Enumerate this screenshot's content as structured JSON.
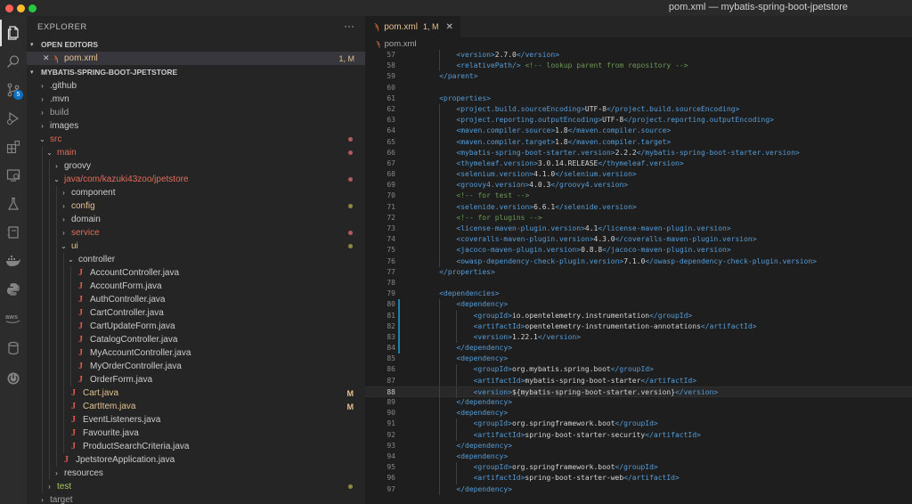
{
  "window": {
    "title": "pom.xml — mybatis-spring-boot-jpetstore"
  },
  "activity_bar": {
    "scm_badge": "5"
  },
  "sidebar": {
    "header": "EXPLORER",
    "more": "···",
    "open_editors": {
      "title": "OPEN EDITORS",
      "items": [
        {
          "close": "✕",
          "name": "pom.xml",
          "status": "1, M"
        }
      ]
    },
    "project": {
      "title": "MYBATIS-SPRING-BOOT-JPETSTORE",
      "tree": [
        {
          "label": ".github",
          "depth": 0,
          "kind": "folder-closed"
        },
        {
          "label": ".mvn",
          "depth": 0,
          "kind": "folder-closed"
        },
        {
          "label": "build",
          "depth": 0,
          "kind": "folder-closed",
          "style": "dim"
        },
        {
          "label": "images",
          "depth": 0,
          "kind": "folder-closed"
        },
        {
          "label": "src",
          "depth": 0,
          "kind": "folder-open",
          "style": "red",
          "deco": "dot-red"
        },
        {
          "label": "main",
          "depth": 1,
          "kind": "folder-open",
          "style": "red",
          "deco": "dot-red"
        },
        {
          "label": "groovy",
          "depth": 2,
          "kind": "folder-closed"
        },
        {
          "label": "java/com/kazuki43zoo/jpetstore",
          "depth": 2,
          "kind": "folder-open",
          "style": "red",
          "deco": "dot-red"
        },
        {
          "label": "component",
          "depth": 3,
          "kind": "folder-closed"
        },
        {
          "label": "config",
          "depth": 3,
          "kind": "folder-closed",
          "style": "gold",
          "deco": "dot-olive"
        },
        {
          "label": "domain",
          "depth": 3,
          "kind": "folder-closed"
        },
        {
          "label": "service",
          "depth": 3,
          "kind": "folder-closed",
          "style": "red",
          "deco": "dot-red"
        },
        {
          "label": "ui",
          "depth": 3,
          "kind": "folder-open",
          "style": "gold",
          "deco": "dot-olive"
        },
        {
          "label": "controller",
          "depth": 4,
          "kind": "folder-open"
        },
        {
          "label": "AccountController.java",
          "depth": 5,
          "kind": "java"
        },
        {
          "label": "AccountForm.java",
          "depth": 5,
          "kind": "java"
        },
        {
          "label": "AuthController.java",
          "depth": 5,
          "kind": "java"
        },
        {
          "label": "CartController.java",
          "depth": 5,
          "kind": "java"
        },
        {
          "label": "CartUpdateForm.java",
          "depth": 5,
          "kind": "java"
        },
        {
          "label": "CatalogController.java",
          "depth": 5,
          "kind": "java"
        },
        {
          "label": "MyAccountController.java",
          "depth": 5,
          "kind": "java"
        },
        {
          "label": "MyOrderController.java",
          "depth": 5,
          "kind": "java"
        },
        {
          "label": "OrderForm.java",
          "depth": 5,
          "kind": "java"
        },
        {
          "label": "Cart.java",
          "depth": 4,
          "kind": "java",
          "style": "gold",
          "deco": "M"
        },
        {
          "label": "CartItem.java",
          "depth": 4,
          "kind": "java",
          "style": "gold",
          "deco": "M"
        },
        {
          "label": "EventListeners.java",
          "depth": 4,
          "kind": "java"
        },
        {
          "label": "Favourite.java",
          "depth": 4,
          "kind": "java"
        },
        {
          "label": "ProductSearchCriteria.java",
          "depth": 4,
          "kind": "java"
        },
        {
          "label": "JpetstoreApplication.java",
          "depth": 3,
          "kind": "java"
        },
        {
          "label": "resources",
          "depth": 2,
          "kind": "folder-closed"
        },
        {
          "label": "test",
          "depth": 1,
          "kind": "folder-closed",
          "style": "green",
          "deco": "dot-olive"
        },
        {
          "label": "target",
          "depth": 0,
          "kind": "folder-closed",
          "style": "dim"
        }
      ]
    }
  },
  "editor": {
    "tab": {
      "name": "pom.xml",
      "status": "1, M",
      "close": "✕"
    },
    "breadcrumb": "pom.xml",
    "current_line": 88,
    "lines": [
      {
        "n": 57,
        "indent": 2,
        "parts": [
          [
            "t",
            "<version>"
          ],
          [
            "x",
            "2.7.0"
          ],
          [
            "t",
            "</version>"
          ]
        ]
      },
      {
        "n": 58,
        "indent": 2,
        "parts": [
          [
            "t",
            "<relativePath/>"
          ],
          [
            "x",
            " "
          ],
          [
            "c",
            "<!-- lookup parent from repository -->"
          ]
        ]
      },
      {
        "n": 59,
        "indent": 1,
        "parts": [
          [
            "t",
            "</parent>"
          ]
        ]
      },
      {
        "n": 60,
        "indent": 0,
        "parts": []
      },
      {
        "n": 61,
        "indent": 1,
        "parts": [
          [
            "t",
            "<properties>"
          ]
        ]
      },
      {
        "n": 62,
        "indent": 2,
        "parts": [
          [
            "t",
            "<project.build.sourceEncoding>"
          ],
          [
            "x",
            "UTF-8"
          ],
          [
            "t",
            "</project.build.sourceEncoding>"
          ]
        ]
      },
      {
        "n": 63,
        "indent": 2,
        "parts": [
          [
            "t",
            "<project.reporting.outputEncoding>"
          ],
          [
            "x",
            "UTF-8"
          ],
          [
            "t",
            "</project.reporting.outputEncoding>"
          ]
        ]
      },
      {
        "n": 64,
        "indent": 2,
        "parts": [
          [
            "t",
            "<maven.compiler.source>"
          ],
          [
            "x",
            "1.8"
          ],
          [
            "t",
            "</maven.compiler.source>"
          ]
        ]
      },
      {
        "n": 65,
        "indent": 2,
        "parts": [
          [
            "t",
            "<maven.compiler.target>"
          ],
          [
            "x",
            "1.8"
          ],
          [
            "t",
            "</maven.compiler.target>"
          ]
        ]
      },
      {
        "n": 66,
        "indent": 2,
        "parts": [
          [
            "t",
            "<mybatis-spring-boot-starter.version>"
          ],
          [
            "x",
            "2.2.2"
          ],
          [
            "t",
            "</mybatis-spring-boot-starter.version>"
          ]
        ]
      },
      {
        "n": 67,
        "indent": 2,
        "parts": [
          [
            "t",
            "<thymeleaf.version>"
          ],
          [
            "x",
            "3.0.14.RELEASE"
          ],
          [
            "t",
            "</thymeleaf.version>"
          ]
        ]
      },
      {
        "n": 68,
        "indent": 2,
        "parts": [
          [
            "t",
            "<selenium.version>"
          ],
          [
            "x",
            "4.1.0"
          ],
          [
            "t",
            "</selenium.version>"
          ]
        ]
      },
      {
        "n": 69,
        "indent": 2,
        "parts": [
          [
            "t",
            "<groovy4.version>"
          ],
          [
            "x",
            "4.0.3"
          ],
          [
            "t",
            "</groovy4.version>"
          ]
        ]
      },
      {
        "n": 70,
        "indent": 2,
        "parts": [
          [
            "c",
            "<!-- for test -->"
          ]
        ]
      },
      {
        "n": 71,
        "indent": 2,
        "parts": [
          [
            "t",
            "<selenide.version>"
          ],
          [
            "x",
            "6.6.1"
          ],
          [
            "t",
            "</selenide.version>"
          ]
        ]
      },
      {
        "n": 72,
        "indent": 2,
        "parts": [
          [
            "c",
            "<!-- for plugins -->"
          ]
        ]
      },
      {
        "n": 73,
        "indent": 2,
        "parts": [
          [
            "t",
            "<license-maven-plugin.version>"
          ],
          [
            "x",
            "4.1"
          ],
          [
            "t",
            "</license-maven-plugin.version>"
          ]
        ]
      },
      {
        "n": 74,
        "indent": 2,
        "parts": [
          [
            "t",
            "<coveralls-maven-plugin.version>"
          ],
          [
            "x",
            "4.3.0"
          ],
          [
            "t",
            "</coveralls-maven-plugin.version>"
          ]
        ]
      },
      {
        "n": 75,
        "indent": 2,
        "parts": [
          [
            "t",
            "<jacoco-maven-plugin.version>"
          ],
          [
            "x",
            "0.8.8"
          ],
          [
            "t",
            "</jacoco-maven-plugin.version>"
          ]
        ]
      },
      {
        "n": 76,
        "indent": 2,
        "parts": [
          [
            "t",
            "<owasp-dependency-check-plugin.version>"
          ],
          [
            "x",
            "7.1.0"
          ],
          [
            "t",
            "</owasp-dependency-check-plugin.version>"
          ]
        ]
      },
      {
        "n": 77,
        "indent": 1,
        "parts": [
          [
            "t",
            "</properties>"
          ]
        ]
      },
      {
        "n": 78,
        "indent": 0,
        "parts": []
      },
      {
        "n": 79,
        "indent": 1,
        "parts": [
          [
            "t",
            "<dependencies>"
          ]
        ]
      },
      {
        "n": 80,
        "indent": 2,
        "mod": true,
        "parts": [
          [
            "t",
            "<dependency>"
          ]
        ]
      },
      {
        "n": 81,
        "indent": 3,
        "mod": true,
        "parts": [
          [
            "t",
            "<groupId>"
          ],
          [
            "x",
            "io.opentelemetry.instrumentation"
          ],
          [
            "t",
            "</groupId>"
          ]
        ]
      },
      {
        "n": 82,
        "indent": 3,
        "mod": true,
        "parts": [
          [
            "t",
            "<artifactId>"
          ],
          [
            "x",
            "opentelemetry-instrumentation-annotations"
          ],
          [
            "t",
            "</artifactId>"
          ]
        ]
      },
      {
        "n": 83,
        "indent": 3,
        "mod": true,
        "parts": [
          [
            "t",
            "<version>"
          ],
          [
            "x",
            "1.22.1"
          ],
          [
            "t",
            "</version>"
          ]
        ]
      },
      {
        "n": 84,
        "indent": 2,
        "mod": true,
        "parts": [
          [
            "t",
            "</dependency>"
          ]
        ]
      },
      {
        "n": 85,
        "indent": 2,
        "parts": [
          [
            "t",
            "<dependency>"
          ]
        ]
      },
      {
        "n": 86,
        "indent": 3,
        "parts": [
          [
            "t",
            "<groupId>"
          ],
          [
            "x",
            "org.mybatis.spring.boot"
          ],
          [
            "t",
            "</groupId>"
          ]
        ]
      },
      {
        "n": 87,
        "indent": 3,
        "parts": [
          [
            "t",
            "<artifactId>"
          ],
          [
            "x",
            "mybatis-spring-boot-starter"
          ],
          [
            "t",
            "</artifactId>"
          ]
        ]
      },
      {
        "n": 88,
        "indent": 3,
        "parts": [
          [
            "t",
            "<version>"
          ],
          [
            "x",
            "${mybatis-spring-boot-starter.version}"
          ],
          [
            "t",
            "</version>"
          ]
        ]
      },
      {
        "n": 89,
        "indent": 2,
        "parts": [
          [
            "t",
            "</dependency>"
          ]
        ]
      },
      {
        "n": 90,
        "indent": 2,
        "parts": [
          [
            "t",
            "<dependency>"
          ]
        ]
      },
      {
        "n": 91,
        "indent": 3,
        "parts": [
          [
            "t",
            "<groupId>"
          ],
          [
            "x",
            "org.springframework.boot"
          ],
          [
            "t",
            "</groupId>"
          ]
        ]
      },
      {
        "n": 92,
        "indent": 3,
        "parts": [
          [
            "t",
            "<artifactId>"
          ],
          [
            "x",
            "spring-boot-starter-security"
          ],
          [
            "t",
            "</artifactId>"
          ]
        ]
      },
      {
        "n": 93,
        "indent": 2,
        "parts": [
          [
            "t",
            "</dependency>"
          ]
        ]
      },
      {
        "n": 94,
        "indent": 2,
        "parts": [
          [
            "t",
            "<dependency>"
          ]
        ]
      },
      {
        "n": 95,
        "indent": 3,
        "parts": [
          [
            "t",
            "<groupId>"
          ],
          [
            "x",
            "org.springframework.boot"
          ],
          [
            "t",
            "</groupId>"
          ]
        ]
      },
      {
        "n": 96,
        "indent": 3,
        "parts": [
          [
            "t",
            "<artifactId>"
          ],
          [
            "x",
            "spring-boot-starter-web"
          ],
          [
            "t",
            "</artifactId>"
          ]
        ]
      },
      {
        "n": 97,
        "indent": 2,
        "parts": [
          [
            "t",
            "</dependency>"
          ]
        ]
      }
    ]
  },
  "colors": {
    "accent": "#0e70c0",
    "modified": "#e2c08d",
    "error_folder": "#e06c58",
    "xml_tag": "#569cd6",
    "comment": "#6a9955"
  }
}
